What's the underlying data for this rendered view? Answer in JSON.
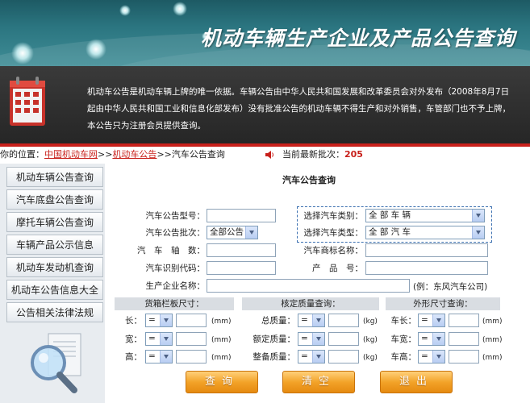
{
  "header": {
    "title": "机动车辆生产企业及产品公告查询"
  },
  "notice": {
    "line1": "机动车公告是机动车辆上牌的唯一依据。车辆公告由中华人民共和国发展和改革委员会对外发布（2008年8月7日",
    "line2": "起由中华人民共和国工业和信息化部发布）没有批准公告的机动车辆不得生产和对外销售，车管部门也不予上牌，",
    "line3": "本公告只为注册会员提供查询。"
  },
  "location": {
    "prefix": "你的位置：",
    "crumb1": "中国机动车网",
    "sep1": ">>",
    "crumb2": "机动车公告",
    "sep2": ">>",
    "current": "汽车公告查询",
    "batch_label": "当前最新批次：",
    "batch_value": "205"
  },
  "sidebar": {
    "items": [
      {
        "label": "机动车辆公告查询"
      },
      {
        "label": "汽车底盘公告查询"
      },
      {
        "label": "摩托车辆公告查询"
      },
      {
        "label": "车辆产品公示信息"
      },
      {
        "label": "机动车发动机查询"
      },
      {
        "label": "机动车公告信息大全"
      },
      {
        "label": "公告相关法律法规"
      }
    ]
  },
  "form": {
    "title": "汽车公告查询",
    "model_label": "汽车公告型号：",
    "batch_label": "汽车公告批次：",
    "batch_value": "全部公告",
    "axles_label": "汽　车　轴　数：",
    "vin_label": "汽车识别代码：",
    "maker_label": "生产企业名称：",
    "category_label": "选择汽车类别：",
    "category_value": "全 部 车 辆",
    "type_label": "选择汽车类型：",
    "type_value": "全 部 汽 车",
    "brand_label": "汽车商标名称：",
    "product_label": "产　品　号：",
    "example": "(例：东风汽车公司)"
  },
  "dims": {
    "cargo_head": "货箱栏板尺寸：",
    "mass_head": "核定质量查询：",
    "outer_head": "外形尺寸查询：",
    "op": "=",
    "len_label": "长：",
    "wid_label": "宽：",
    "hei_label": "高：",
    "total_mass_label": "总质量：",
    "rated_mass_label": "额定质量：",
    "curb_mass_label": "整备质量：",
    "car_len_label": "车长：",
    "car_wid_label": "车宽：",
    "car_hei_label": "车高：",
    "unit_mm": "(mm)",
    "unit_kg": "(kg)"
  },
  "buttons": {
    "query": "查询",
    "clear": "清空",
    "exit": "退出"
  },
  "colors": {
    "accent_red": "#c8201b",
    "banner_teal": "#2b7580",
    "button_orange": "#f3a329"
  }
}
